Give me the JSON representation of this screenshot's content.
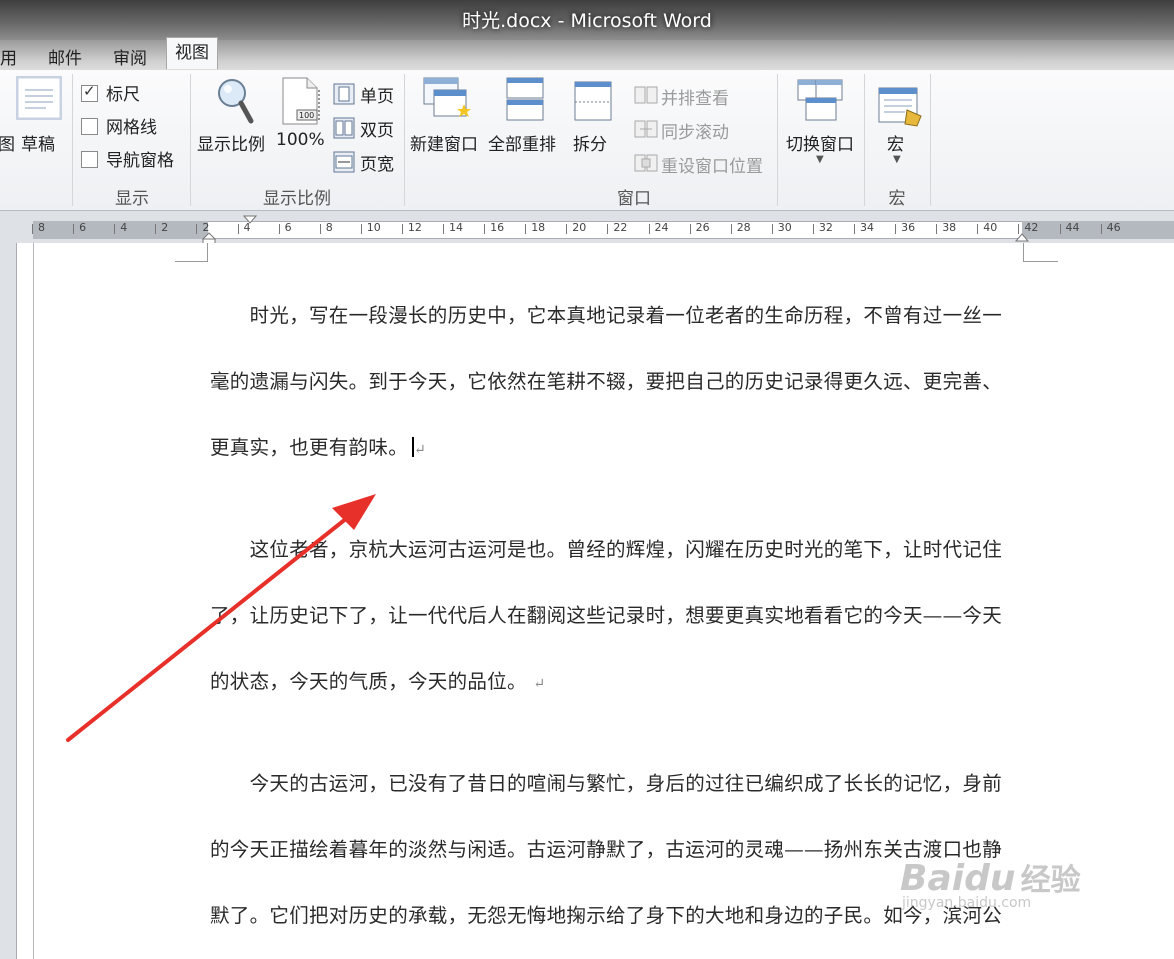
{
  "window": {
    "title": "时光.docx - Microsoft Word"
  },
  "tabs": [
    {
      "label": "用"
    },
    {
      "label": "邮件"
    },
    {
      "label": "审阅"
    },
    {
      "label": "视图"
    }
  ],
  "ribbon": {
    "views": {
      "partial_label": "图",
      "draft": "草稿"
    },
    "show": {
      "ruler": "标尺",
      "ruler_checked": true,
      "gridlines": "网格线",
      "gridlines_checked": false,
      "nav_pane": "导航窗格",
      "nav_pane_checked": false,
      "group_label": "显示"
    },
    "zoom": {
      "zoom": "显示比例",
      "hundred": "100%",
      "one_page": "单页",
      "two_pages": "双页",
      "page_width": "页宽",
      "group_label": "显示比例"
    },
    "window": {
      "new_window": "新建窗口",
      "arrange_all": "全部重排",
      "split": "拆分",
      "side_by_side": "并排查看",
      "sync_scroll": "同步滚动",
      "reset_position": "重设窗口位置",
      "switch_windows": "切换窗口",
      "group_label": "窗口"
    },
    "macros": {
      "macros": "宏",
      "group_label": "宏"
    }
  },
  "ruler": {
    "ticks": [
      "8",
      "6",
      "4",
      "2",
      "2",
      "4",
      "6",
      "8",
      "10",
      "12",
      "14",
      "16",
      "18",
      "20",
      "22",
      "24",
      "26",
      "28",
      "30",
      "32",
      "34",
      "36",
      "38",
      "40",
      "42",
      "44",
      "46"
    ]
  },
  "document": {
    "paragraphs": [
      {
        "lines": [
          "　　时光，写在一段漫长的历史中，它本真地记录着一位老者的生命历程，不曾有过一丝一",
          "毫的遗漏与闪失。到于今天，它依然在笔耕不辍，要把自己的历史记录得更久远、更完善、",
          "更真实，也更有韵味。"
        ]
      },
      {
        "lines": [
          "　　这位老者，京杭大运河古运河是也。曾经的辉煌，闪耀在历史时光的笔下，让时代记住",
          "了，让历史记下了，让一代代后人在翻阅这些记录时，想要更真实地看看它的今天——今天",
          "的状态，今天的气质，今天的品位。"
        ]
      },
      {
        "lines": [
          "　　今天的古运河，已没有了昔日的喧闹与繁忙，身后的过往已编织成了长长的记忆，身前",
          "的今天正描绘着暮年的淡然与闲适。古运河静默了，古运河的灵魂——扬州东关古渡口也静",
          "默了。它们把对历史的承载，无怨无悔地掬示给了身下的大地和身边的子民。如今，滨河公"
        ]
      }
    ],
    "paragraph_mark": "↵"
  },
  "watermark": {
    "brand": "Bai",
    "brand2": "du",
    "product": "经验",
    "url": "jingyan.baidu.com"
  },
  "colors": {
    "arrow": "#e8302a",
    "titlebar": "#4a4a4a"
  }
}
